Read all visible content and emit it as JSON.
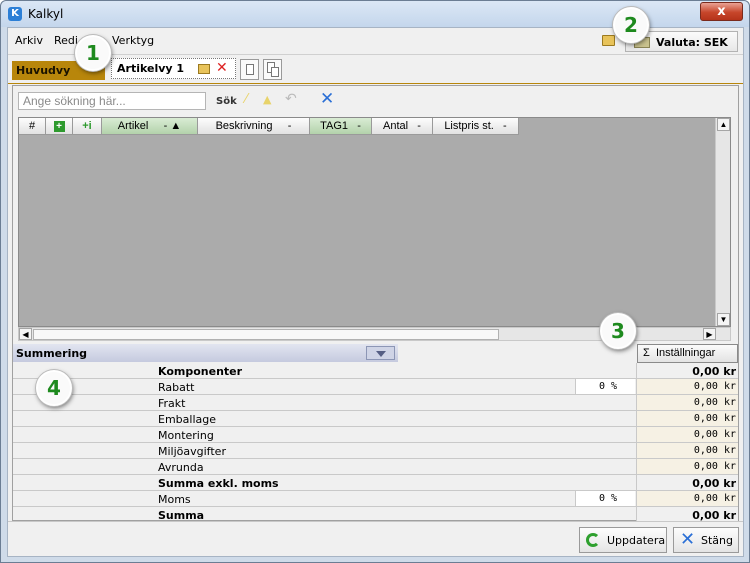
{
  "window": {
    "title": "Kalkyl",
    "close_glyph": "x"
  },
  "menu": {
    "items": [
      "Arkiv",
      "Redigera",
      "Verktyg"
    ],
    "item_visible": [
      "Arkiv",
      "Redi",
      "Verktyg"
    ]
  },
  "currency": {
    "label": "Valuta: SEK"
  },
  "tabs": {
    "main": "Huvudvy",
    "article": "Artikelvy 1"
  },
  "search": {
    "placeholder": "Ange sökning här...",
    "label": "Sök"
  },
  "grid": {
    "columns": [
      {
        "label": "#"
      },
      {
        "label": "+",
        "icon": "plus-icon"
      },
      {
        "label": "+i",
        "icon": "add-info-icon"
      },
      {
        "label": "Artikel",
        "sort": "-  ▲"
      },
      {
        "label": "Beskrivning",
        "sort": "-"
      },
      {
        "label": "TAG1",
        "sort": "-"
      },
      {
        "label": "Antal",
        "sort": "-"
      },
      {
        "label": "Listpris st.",
        "sort": "-"
      }
    ]
  },
  "summary": {
    "title": "Summering",
    "settings_label": "Inställningar",
    "settings_glyph": "Σ",
    "rows": [
      {
        "label": "Komponenter",
        "bold": true,
        "pct": "",
        "amount": "0,00 kr"
      },
      {
        "label": "Rabatt",
        "bold": false,
        "pct": "0 %",
        "amount": "0,00 kr"
      },
      {
        "label": "Frakt",
        "bold": false,
        "pct": "",
        "amount": "0,00 kr"
      },
      {
        "label": "Emballage",
        "bold": false,
        "pct": "",
        "amount": "0,00 kr"
      },
      {
        "label": "Montering",
        "bold": false,
        "pct": "",
        "amount": "0,00 kr"
      },
      {
        "label": "Miljöavgifter",
        "bold": false,
        "pct": "",
        "amount": "0,00 kr"
      },
      {
        "label": "Avrunda",
        "bold": false,
        "pct": "",
        "amount": "0,00 kr"
      },
      {
        "label": "Summa exkl. moms",
        "bold": true,
        "pct": "",
        "amount": "0,00 kr"
      },
      {
        "label": "Moms",
        "bold": false,
        "pct": "0 %",
        "amount": "0,00 kr"
      },
      {
        "label": "Summa",
        "bold": true,
        "pct": "",
        "amount": "0,00 kr"
      }
    ]
  },
  "buttons": {
    "update": "Uppdatera",
    "close": "Stäng"
  },
  "callouts": [
    "1",
    "2",
    "3",
    "4"
  ],
  "colors": {
    "main_tab": "#b8860b",
    "grid_bg": "#ababab",
    "summary_header": "#c5cadf",
    "callout_text": "#1e8a1e"
  }
}
